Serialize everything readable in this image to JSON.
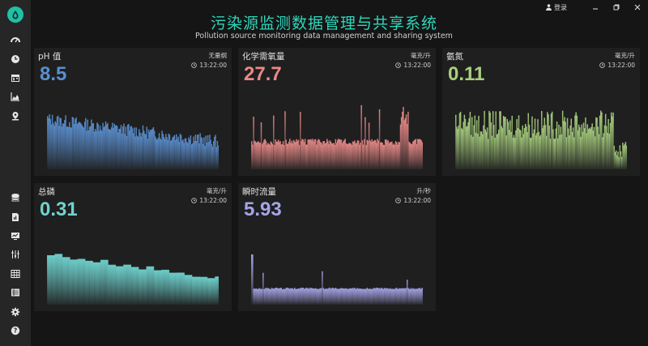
{
  "app": {
    "title": "污染源监测数据管理与共享系统",
    "subtitle": "Pollution source monitoring data management and sharing system"
  },
  "topbar": {
    "login_label": "登录"
  },
  "colors": {
    "accent": "#2fd6bc",
    "panel_bg": "#1f1f1f",
    "page_bg": "#151515",
    "sidebar_bg": "#262626"
  },
  "sidebar": {
    "items": [
      {
        "icon": "dashboard-icon"
      },
      {
        "icon": "clock-icon"
      },
      {
        "icon": "calendar-icon"
      },
      {
        "icon": "area-chart-icon"
      },
      {
        "icon": "location-icon"
      },
      {
        "icon": "database-icon"
      },
      {
        "icon": "file-chart-icon"
      },
      {
        "icon": "monitor-chart-icon"
      },
      {
        "icon": "sliders-icon"
      },
      {
        "icon": "table-icon"
      },
      {
        "icon": "list-table-icon"
      },
      {
        "icon": "gear-icon"
      },
      {
        "icon": "help-icon"
      }
    ]
  },
  "panels": [
    {
      "name": "pH 值",
      "unit": "无量纲",
      "time": "13:22:00",
      "value": "8.5",
      "color": "#5a8fcf",
      "chart": "pH"
    },
    {
      "name": "化学需氧量",
      "unit": "毫克/升",
      "time": "13:22:00",
      "value": "27.7",
      "color": "#e88a88",
      "chart": "cod"
    },
    {
      "name": "氨氮",
      "unit": "毫克/升",
      "time": "13:22:00",
      "value": "0.11",
      "color": "#a9d07f",
      "chart": "nh3"
    },
    {
      "name": "总磷",
      "unit": "毫克/升",
      "time": "13:22:00",
      "value": "0.31",
      "color": "#6fd3cf",
      "chart": "tp"
    },
    {
      "name": "瞬时流量",
      "unit": "升/秒",
      "time": "13:22:00",
      "value": "5.93",
      "color": "#a5a4e8",
      "chart": "flow"
    }
  ]
}
